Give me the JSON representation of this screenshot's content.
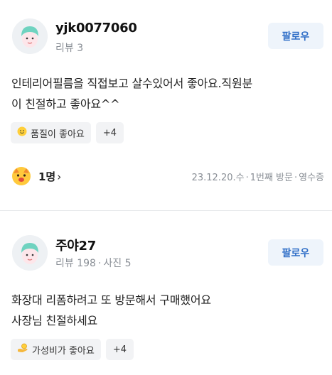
{
  "reviews": [
    {
      "username": "yjk0077060",
      "meta_reviews": "리뷰 3",
      "meta_photos": "",
      "follow_label": "팔로우",
      "text_line1": "인테리어필름을 직접보고 살수있어서 좋아요.직원분",
      "text_line2": "이 친절하고 좋아요^^",
      "tag_label": "품질이 좋아요",
      "tag_icon": "thumbs-smile-icon",
      "tag_more": "+4",
      "reaction_count": "1명",
      "date": "23.12.20.수",
      "visit_count": "1번째 방문",
      "verification": "영수증"
    },
    {
      "username": "주야27",
      "meta_reviews": "리뷰 198",
      "meta_photos": "사진 5",
      "follow_label": "팔로우",
      "text_line1": "화장대 리폼하려고 또 방문해서 구매했어요",
      "text_line2": "사장님 친절하세요",
      "tag_label": "가성비가 좋아요",
      "tag_icon": "coin-hand-icon",
      "tag_more": "+4"
    }
  ],
  "colors": {
    "follow_bg": "#eef4fb",
    "follow_text": "#2f6ec7",
    "meta_text": "#8a8f96",
    "tag_bg": "#f2f3f5"
  }
}
